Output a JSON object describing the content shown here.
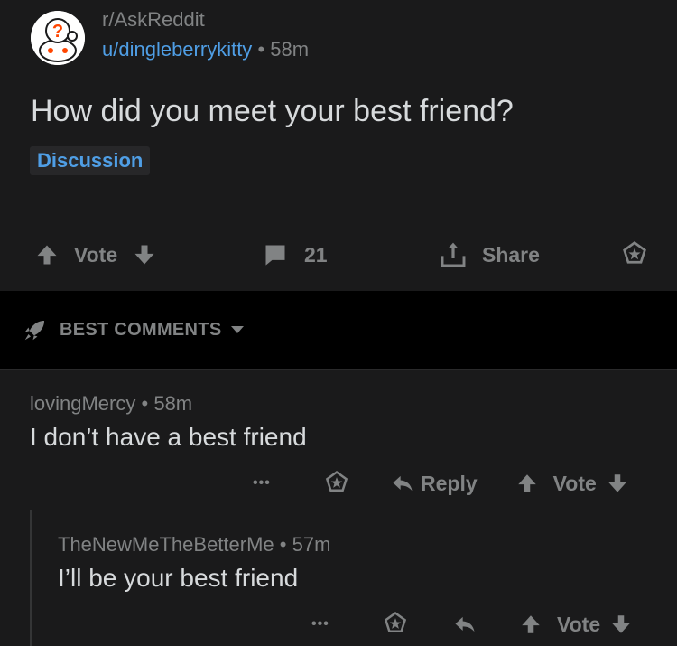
{
  "post": {
    "subreddit": "r/AskReddit",
    "author": "u/dingleberrykitty",
    "separator": "•",
    "age": "58m",
    "title": "How did you meet your best friend?",
    "flair": "Discussion",
    "actions": {
      "vote_label": "Vote",
      "comment_count": "21",
      "share_label": "Share"
    },
    "icons": [
      "snoo-avatar-icon",
      "upvote-icon",
      "downvote-icon",
      "comment-icon",
      "share-icon",
      "award-icon"
    ]
  },
  "sort": {
    "label": "BEST COMMENTS",
    "icon": "rocket-icon"
  },
  "comments": [
    {
      "author": "lovingMercy",
      "age": "58m",
      "body": "I don’t have a best friend",
      "more": "•••",
      "reply_label": "Reply",
      "vote_label": "Vote"
    },
    {
      "author": "TheNewMeTheBetterMe",
      "age": "57m",
      "body": "I’ll be your best friend",
      "more": "•••",
      "vote_label": "Vote"
    }
  ],
  "colors": {
    "background": "#1a1a1b",
    "band": "#000000",
    "text": "#d7dadc",
    "muted": "#818384",
    "link": "#4f9ee5"
  }
}
